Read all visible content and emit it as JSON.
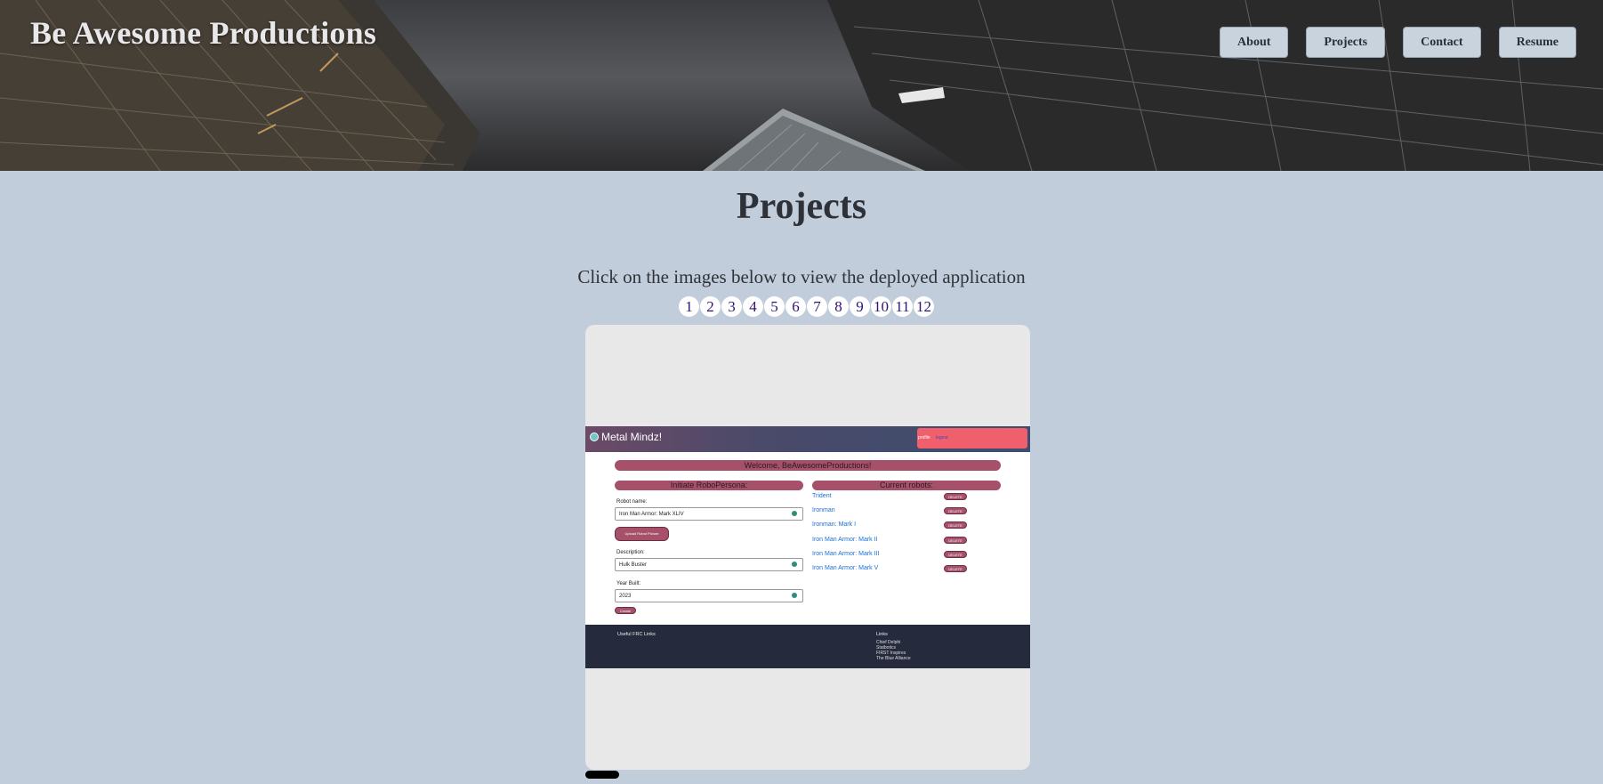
{
  "header": {
    "brand": "Be Awesome Productions",
    "nav": [
      "About",
      "Projects",
      "Contact",
      "Resume"
    ]
  },
  "main": {
    "title": "Projects",
    "instructions": "Click on the images below to view the deployed application",
    "pages": [
      "1",
      "2",
      "3",
      "4",
      "5",
      "6",
      "7",
      "8",
      "9",
      "10",
      "11",
      "12"
    ]
  },
  "slide": {
    "app_name": "Metal Mindz!",
    "profile": "profile",
    "logout": "logout",
    "welcome": "Welcome, BeAwesomeProductions!",
    "form_title": "Initiate RoboPersona:",
    "robot_name_label": "Robot name:",
    "robot_name_value": "Iron Man Armor: Mark XLIV",
    "upload_label": "Upload Robot Picture",
    "description_label": "Description:",
    "description_value": "Hulk Buster",
    "year_label": "Year Built:",
    "year_value": "2023",
    "create_label": "Create",
    "list_title": "Current robots:",
    "robots": [
      "Trident",
      "Ironman",
      "Ironman: Mark I",
      "Iron Man Armor: Mark II",
      "Iron Man Armor: Mark III",
      "Iron Man Armor: Mark V"
    ],
    "delete_label": "DELETE",
    "footer_left_title": "Useful FRC Links",
    "footer_right_title": "Links",
    "footer_links": [
      "Chief Delphi",
      "Statbotics",
      "FIRST Inspires",
      "The Blue Alliance"
    ]
  },
  "colors": {
    "page_bg": "#c1cdda",
    "app_accent": "#a6506a",
    "app_footer": "#252a3d",
    "logout_bar": "#f0606c"
  }
}
